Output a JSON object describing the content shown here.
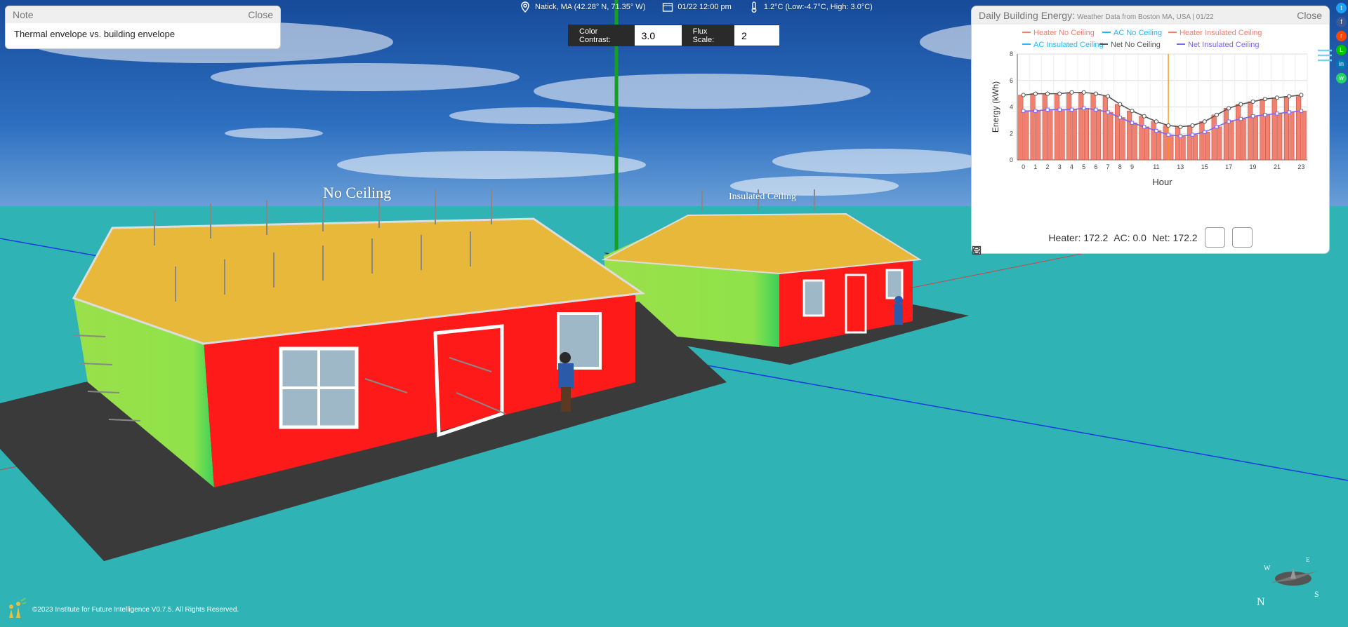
{
  "topbar": {
    "location": "Natick, MA (42.28° N, 71.35° W)",
    "datetime": "01/22 12:00 pm",
    "weather": "1.2°C (Low:-4.7°C, High: 3.0°C)"
  },
  "controls": {
    "color_contrast_label": "Color Contrast:",
    "color_contrast_value": "3.0",
    "flux_scale_label": "Flux Scale:",
    "flux_scale_value": "2"
  },
  "note": {
    "title": "Note",
    "close": "Close",
    "text": "Thermal envelope vs. building envelope"
  },
  "scene_labels": {
    "house1": "No Ceiling",
    "house2": "Insulated Ceiling"
  },
  "chart_panel": {
    "title": "Daily Building Energy:",
    "subtitle": "Weather Data from Boston MA, USA | 01/22",
    "close": "Close",
    "summary_heater": "Heater: 172.2",
    "summary_ac": "AC: 0.0",
    "summary_net": "Net: 172.2"
  },
  "chart_data": {
    "type": "bar",
    "xlabel": "Hour",
    "ylabel": "Energy (kWh)",
    "ylim": [
      0,
      8
    ],
    "yticks": [
      0,
      2,
      4,
      6,
      8
    ],
    "xtick_labels": [
      "0",
      "1",
      "2",
      "3",
      "4",
      "5",
      "6",
      "7",
      "8",
      "9",
      "11",
      "13",
      "15",
      "17",
      "19",
      "21",
      "23"
    ],
    "x": [
      0,
      1,
      2,
      3,
      4,
      5,
      6,
      7,
      8,
      9,
      10,
      11,
      12,
      13,
      14,
      15,
      16,
      17,
      18,
      19,
      20,
      21,
      22,
      23
    ],
    "current_hour": 12,
    "legend": [
      {
        "name": "Heater No Ceiling",
        "color": "#f08070"
      },
      {
        "name": "AC No Ceiling",
        "color": "#29b6f6"
      },
      {
        "name": "Heater Insulated Ceiling",
        "color": "#f08070"
      },
      {
        "name": "AC Insulated Ceiling",
        "color": "#29b6f6"
      },
      {
        "name": "Net No Ceiling",
        "color": "#555555"
      },
      {
        "name": "Net Insulated Ceiling",
        "color": "#7b68ee"
      }
    ],
    "series": [
      {
        "name": "Heater No Ceiling",
        "values": [
          4.9,
          5.0,
          5.0,
          5.0,
          5.1,
          5.1,
          5.0,
          4.8,
          4.2,
          3.7,
          3.3,
          2.9,
          2.6,
          2.5,
          2.6,
          2.9,
          3.4,
          3.9,
          4.2,
          4.4,
          4.6,
          4.7,
          4.8,
          4.9
        ]
      },
      {
        "name": "Heater Insulated Ceiling",
        "values": [
          3.7,
          3.7,
          3.8,
          3.8,
          3.8,
          3.9,
          3.8,
          3.6,
          3.2,
          2.8,
          2.5,
          2.2,
          1.9,
          1.8,
          1.9,
          2.1,
          2.5,
          2.9,
          3.1,
          3.3,
          3.4,
          3.5,
          3.6,
          3.7
        ]
      },
      {
        "name": "AC No Ceiling",
        "values": [
          0,
          0,
          0,
          0,
          0,
          0,
          0,
          0,
          0,
          0,
          0,
          0,
          0,
          0,
          0,
          0,
          0,
          0,
          0,
          0,
          0,
          0,
          0,
          0
        ]
      },
      {
        "name": "AC Insulated Ceiling",
        "values": [
          0,
          0,
          0,
          0,
          0,
          0,
          0,
          0,
          0,
          0,
          0,
          0,
          0,
          0,
          0,
          0,
          0,
          0,
          0,
          0,
          0,
          0,
          0,
          0
        ]
      },
      {
        "name": "Net No Ceiling",
        "values": [
          4.9,
          5.0,
          5.0,
          5.0,
          5.1,
          5.1,
          5.0,
          4.8,
          4.2,
          3.7,
          3.3,
          2.9,
          2.6,
          2.5,
          2.6,
          2.9,
          3.4,
          3.9,
          4.2,
          4.4,
          4.6,
          4.7,
          4.8,
          4.9
        ]
      },
      {
        "name": "Net Insulated Ceiling",
        "values": [
          3.7,
          3.7,
          3.8,
          3.8,
          3.8,
          3.9,
          3.8,
          3.6,
          3.2,
          2.8,
          2.5,
          2.2,
          1.9,
          1.8,
          1.9,
          2.1,
          2.5,
          2.9,
          3.1,
          3.3,
          3.4,
          3.5,
          3.6,
          3.7
        ]
      }
    ]
  },
  "footer": {
    "copyright": "©2023 Institute for Future Intelligence V0.7.5. All Rights Reserved."
  },
  "colors": {
    "ground": "#2fb3b5",
    "wall_red": "#ff1a1a",
    "wall_green": "#9be04a",
    "roof": "#e8b83a",
    "slab": "#3a3a3a"
  },
  "icons": [
    "location-icon",
    "calendar-icon",
    "thermometer-icon",
    "list-icon",
    "refresh-icon",
    "save-icon",
    "compass-icon",
    "logo-icon"
  ]
}
